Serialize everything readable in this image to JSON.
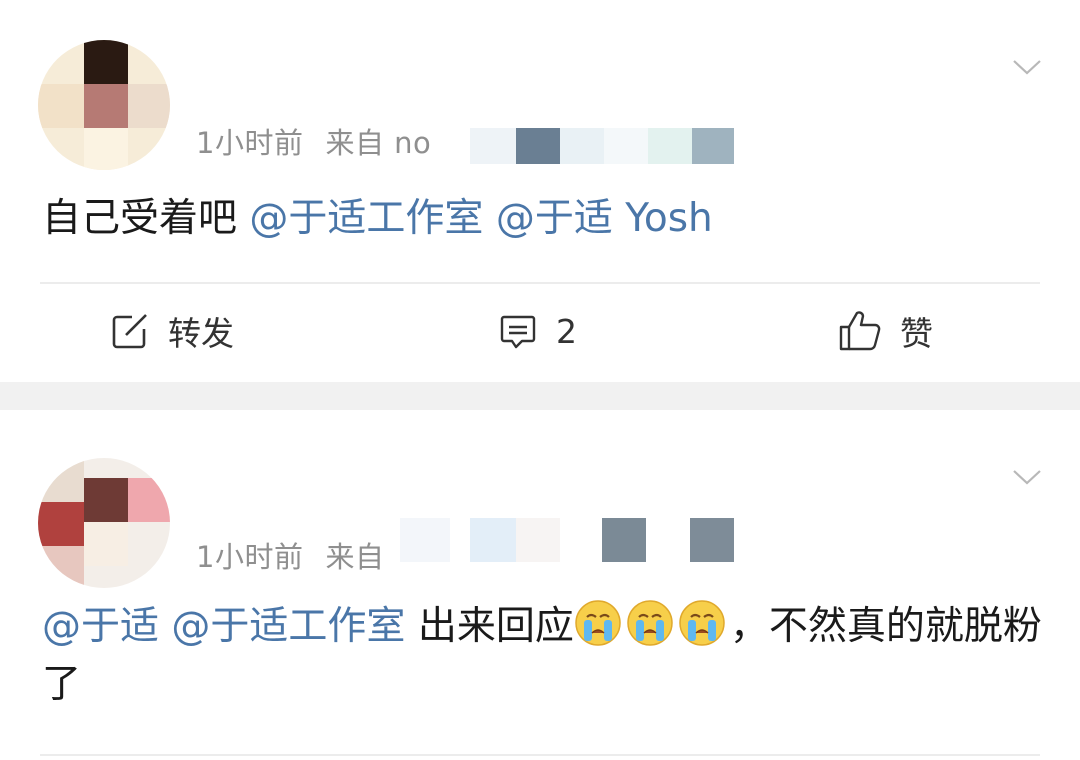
{
  "posts": [
    {
      "time": "1小时前",
      "source_prefix": "来自 no",
      "content": [
        {
          "type": "text",
          "text": "自己受着吧 "
        },
        {
          "type": "mention",
          "text": "@于适工作室"
        },
        {
          "type": "text",
          "text": " "
        },
        {
          "type": "mention",
          "text": "@于适 Yosh"
        }
      ],
      "actions": {
        "repost": "转发",
        "comment": "2",
        "like": "赞"
      }
    },
    {
      "time": "1小时前",
      "source_prefix": "来自",
      "content": [
        {
          "type": "mention",
          "text": "@于适"
        },
        {
          "type": "text",
          "text": " "
        },
        {
          "type": "mention",
          "text": "@于适工作室"
        },
        {
          "type": "text",
          "text": " 出来回应"
        },
        {
          "type": "emoji",
          "name": "crying-emoji"
        },
        {
          "type": "emoji",
          "name": "crying-emoji"
        },
        {
          "type": "emoji",
          "name": "crying-emoji"
        },
        {
          "type": "text",
          "text": "，不然真的就脱粉了"
        }
      ]
    }
  ],
  "icons": {
    "menu": "chevron-down-icon",
    "repost": "share-square-icon",
    "comment": "comment-bubble-icon",
    "like": "thumbs-up-icon"
  },
  "colors": {
    "mention": "#4a76a8",
    "meta": "#8f8f8f",
    "separator": "#f1f1f1"
  }
}
